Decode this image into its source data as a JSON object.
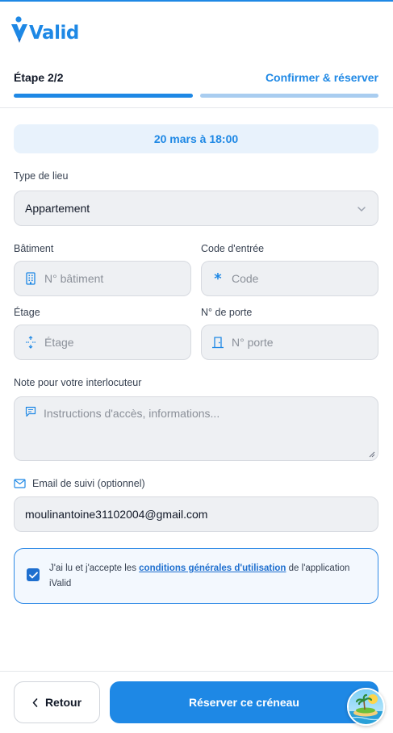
{
  "app": {
    "logo_text": "Valid"
  },
  "steps": {
    "current": "Étape 2/2",
    "next": "Confirmer & réserver",
    "progress_fraction": 0.5
  },
  "booking": {
    "datetime": "20 mars à 18:00"
  },
  "place_type": {
    "label": "Type de lieu",
    "value": "Appartement",
    "icon": "chevron-down-icon"
  },
  "building": {
    "label": "Bâtiment",
    "placeholder": "N° bâtiment",
    "icon": "building-icon"
  },
  "entry_code": {
    "label": "Code d'entrée",
    "placeholder": "Code",
    "icon": "asterisk-icon"
  },
  "floor": {
    "label": "Étage",
    "placeholder": "Étage",
    "icon": "floor-arrows-icon"
  },
  "door": {
    "label": "N° de porte",
    "placeholder": "N° porte",
    "icon": "door-icon"
  },
  "note": {
    "label": "Note pour votre interlocuteur",
    "placeholder": "Instructions d'accès, informations...",
    "icon": "message-icon"
  },
  "email": {
    "label": "Email de suivi (optionnel)",
    "value": "moulinantoine31102004@gmail.com",
    "icon": "mail-icon"
  },
  "consent": {
    "checked": true,
    "text_before": "J'ai lu et j'accepte les ",
    "link_text": "conditions générales d'utilisation",
    "text_after": " de l'application iValid"
  },
  "footer": {
    "back_label": "Retour",
    "submit_label": "Réserver ce créneau"
  },
  "colors": {
    "primary": "#1e88e5",
    "primary_light": "#a9cdf0",
    "field_bg": "#eef0f3",
    "info_bg": "#e8f2fc"
  }
}
